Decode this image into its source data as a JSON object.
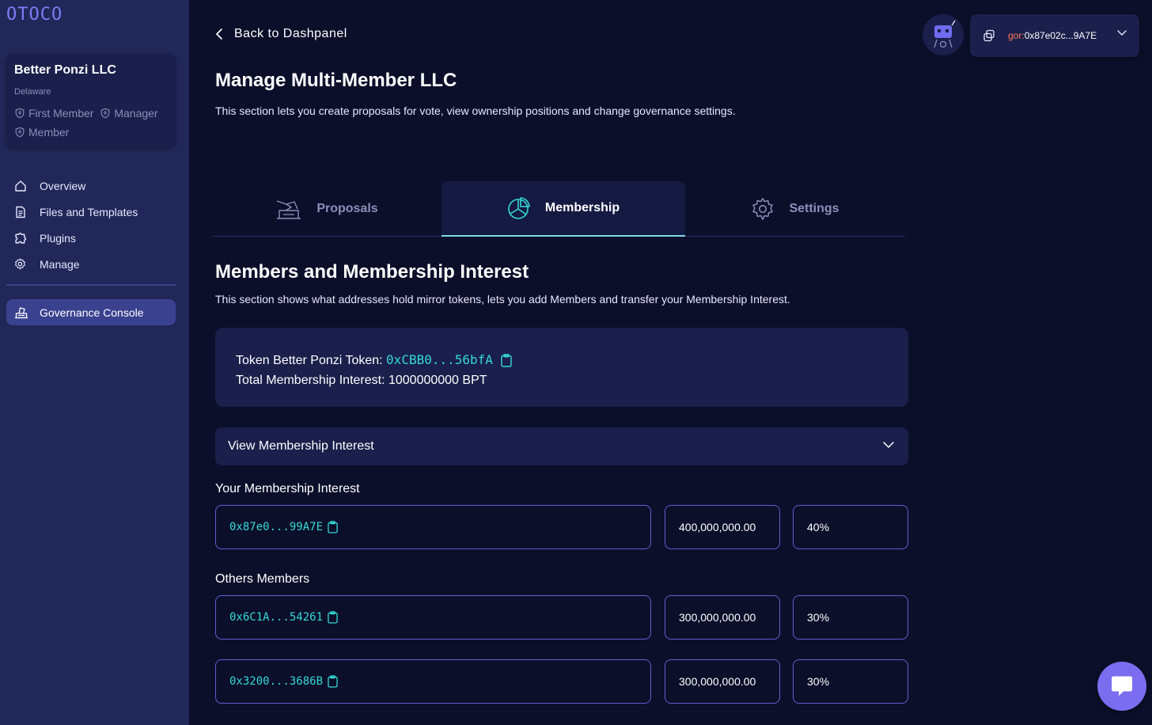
{
  "colors": {
    "background": "#0c0f2a",
    "sidebar": "#212758",
    "card": "#1a1f4b",
    "accent_cyan": "#34d9d6",
    "field_border": "#5b5fd0",
    "network": "#ff7a59"
  },
  "sidebar": {
    "logo": "OTOCO",
    "company": {
      "name": "Better Ponzi LLC",
      "jurisdiction": "Delaware",
      "roles": [
        "First Member",
        "Manager",
        "Member"
      ]
    },
    "items": [
      {
        "label": "Overview",
        "icon": "home-icon"
      },
      {
        "label": "Files and Templates",
        "icon": "document-icon"
      },
      {
        "label": "Plugins",
        "icon": "puzzle-icon"
      },
      {
        "label": "Manage",
        "icon": "gear-icon"
      }
    ],
    "active_item": {
      "label": "Governance Console",
      "icon": "ballot-icon"
    }
  },
  "header": {
    "back_label": "Back to Dashpanel",
    "wallet": {
      "network": "gor:",
      "address": "0x87e02c...9A7E"
    }
  },
  "page": {
    "title": "Manage Multi-Member LLC",
    "description": "This section lets you create proposals for vote, view ownership positions and change governance settings."
  },
  "tabs": [
    {
      "label": "Proposals",
      "icon": "ballot-icon"
    },
    {
      "label": "Membership",
      "icon": "pie-chart-icon",
      "active": true
    },
    {
      "label": "Settings",
      "icon": "gear-icon"
    }
  ],
  "membership": {
    "title": "Members and Membership Interest",
    "description": "This section shows what addresses hold mirror tokens, lets you add Members and transfer your Membership Interest.",
    "token_label": "Token Better Ponzi Token:",
    "token_address": "0xCBB0...56bfA",
    "total_interest": "Total Membership Interest: 1000000000 BPT",
    "accordion_label": "View Membership Interest",
    "your_label": "Your Membership Interest",
    "your": {
      "address": "0x87e0...99A7E",
      "amount": "400,000,000.00",
      "percent": "40%"
    },
    "others_label": "Others Members",
    "others": [
      {
        "address": "0x6C1A...54261",
        "amount": "300,000,000.00",
        "percent": "30%"
      },
      {
        "address": "0x3200...3686B",
        "amount": "300,000,000.00",
        "percent": "30%"
      }
    ]
  }
}
